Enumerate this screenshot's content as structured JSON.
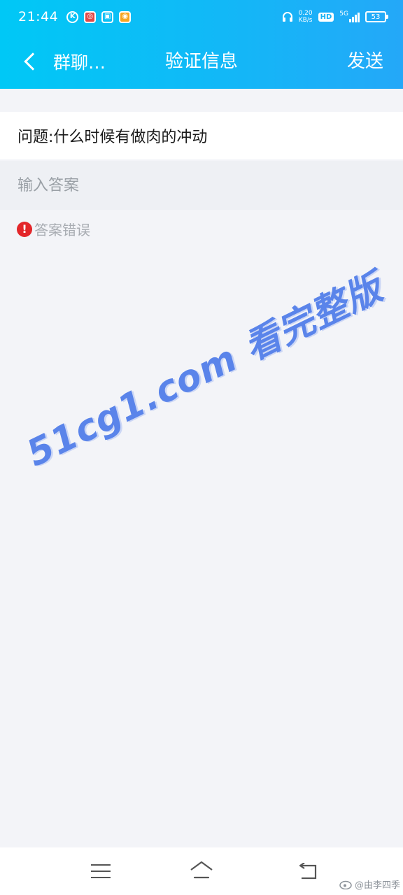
{
  "status_bar": {
    "time": "21:44",
    "app_badges": [
      "K",
      "",
      "",
      ""
    ],
    "net_speed_value": "0.20",
    "net_speed_unit": "KB/s",
    "hd_label": "HD",
    "network_label": "5G",
    "battery": "53"
  },
  "navbar": {
    "back_label": "群聊…",
    "title": "验证信息",
    "send_label": "发送"
  },
  "form": {
    "question": "问题:什么时候有做肉的冲动",
    "answer_placeholder": "输入答案",
    "answer_value": "",
    "error_icon": "!",
    "error_text": "答案错误"
  },
  "overlay": {
    "watermark": "51cg1.com 看完整版",
    "credit": "@由李四季"
  },
  "colors": {
    "header_start": "#00c8f6",
    "header_end": "#24a8f8",
    "error": "#e3262a",
    "watermark": "#5a84ea"
  }
}
